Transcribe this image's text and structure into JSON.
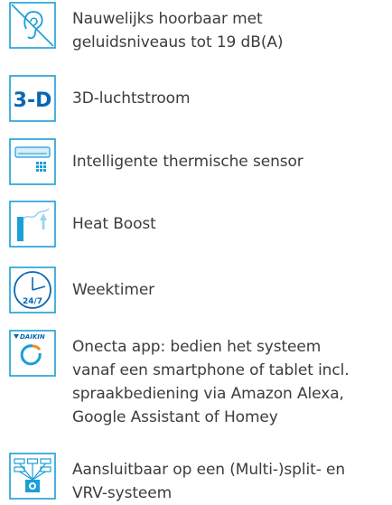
{
  "features": [
    {
      "icon": "quiet-ear-icon",
      "lines": [
        "Nauwelijks hoorbaar met",
        "geluidsniveaus tot 19 dB(A)"
      ]
    },
    {
      "icon": "3d-airflow-icon",
      "icon_text": "3-D",
      "lines": [
        "3D-luchtstroom"
      ]
    },
    {
      "icon": "thermal-sensor-icon",
      "lines": [
        "Intelligente thermische sensor"
      ]
    },
    {
      "icon": "heat-boost-icon",
      "lines": [
        "Heat Boost"
      ]
    },
    {
      "icon": "week-timer-icon",
      "icon_text": "24/7",
      "lines": [
        "Weektimer"
      ]
    },
    {
      "icon": "onecta-app-icon",
      "icon_text": "DAIKIN",
      "lines": [
        "Onecta app: bedien het systeem",
        "vanaf een smartphone of tablet incl.",
        "spraakbediening via Amazon Alexa,",
        "Google Assistant of Homey"
      ]
    },
    {
      "icon": "multi-split-icon",
      "lines": [
        "Aansluitbaar op een (Multi-)split- en",
        "VRV-systeem"
      ]
    }
  ],
  "colors": {
    "accent": "#1a9fd6",
    "dark_blue": "#0b66b0",
    "text": "#3c3c3c"
  }
}
